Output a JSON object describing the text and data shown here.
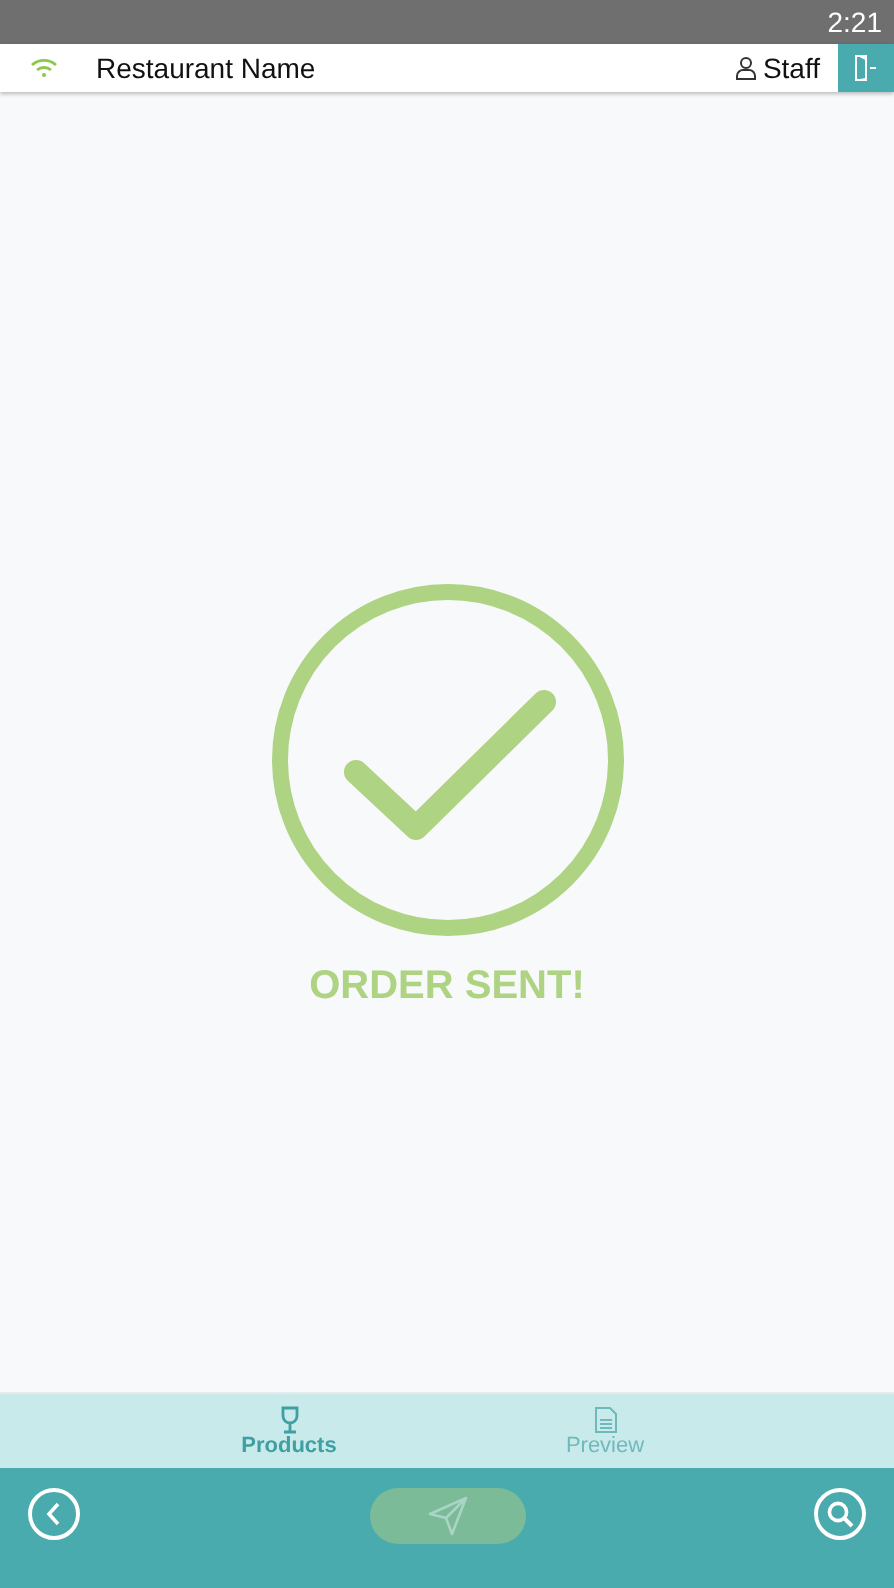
{
  "status_bar": {
    "time": "2:21"
  },
  "header": {
    "title": "Restaurant Name",
    "user": "Staff"
  },
  "message": "ORDER SENT!",
  "tabs": [
    {
      "label": "Products",
      "selected": true,
      "kind": "glass"
    },
    {
      "label": "Preview",
      "selected": false,
      "kind": "document"
    }
  ],
  "send_button": {
    "disabled": true
  }
}
